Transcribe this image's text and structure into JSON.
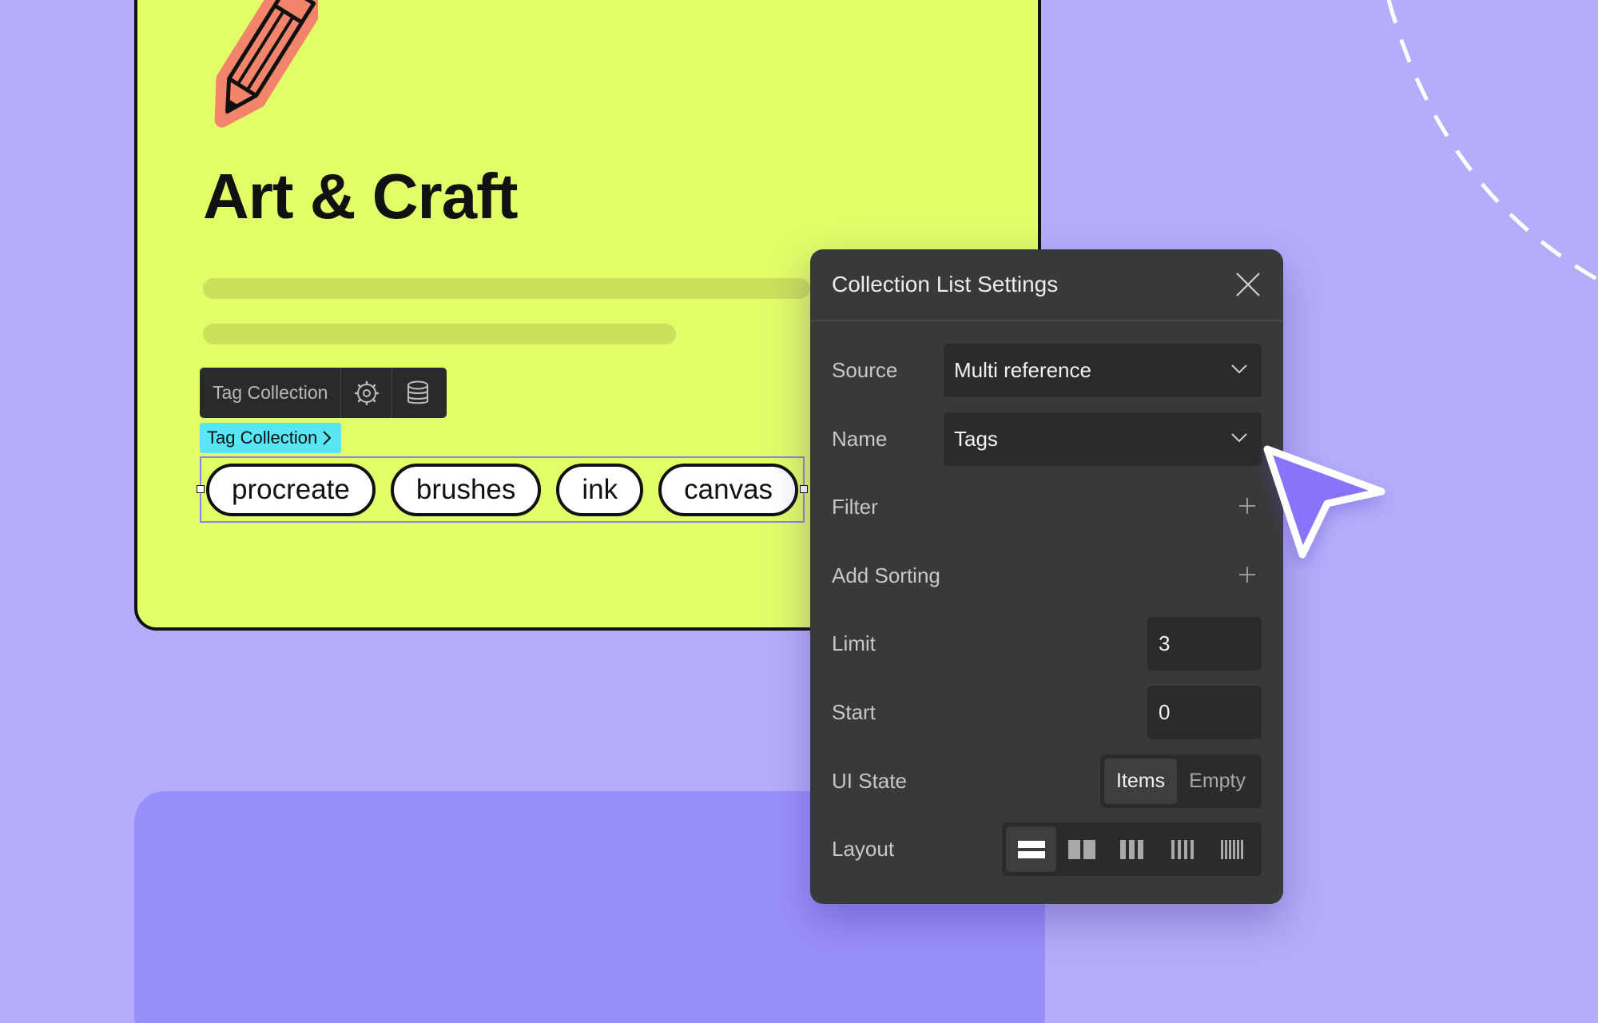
{
  "card": {
    "title": "Art & Craft"
  },
  "element_toolbar": {
    "label": "Tag Collection",
    "settings_icon": "gear-icon",
    "database_icon": "database-icon"
  },
  "breadcrumb": {
    "label": "Tag Collection",
    "icon": "chevron-right-icon"
  },
  "tags": [
    "procreate",
    "brushes",
    "ink",
    "canvas"
  ],
  "panel": {
    "title": "Collection List Settings",
    "close_icon": "close-icon",
    "source": {
      "label": "Source",
      "value": "Multi reference"
    },
    "name": {
      "label": "Name",
      "value": "Tags"
    },
    "filter": {
      "label": "Filter"
    },
    "sorting": {
      "label": "Add Sorting"
    },
    "limit": {
      "label": "Limit",
      "value": "3"
    },
    "start": {
      "label": "Start",
      "value": "0"
    },
    "ui_state": {
      "label": "UI State",
      "options": [
        "Items",
        "Empty"
      ],
      "selected": "Items"
    },
    "layout": {
      "label": "Layout",
      "options": [
        "1-column-layout-icon",
        "2-column-layout-icon",
        "3-column-layout-icon",
        "4-column-layout-icon",
        "6-column-layout-icon"
      ],
      "selected": "1-column-layout-icon"
    }
  },
  "colors": {
    "background": "#b4adfa",
    "card": "#e1fd68",
    "panel": "#393939",
    "breadcrumb": "#58e5f4",
    "cursor": "#8a73fb",
    "pencil": "#f3846c"
  }
}
